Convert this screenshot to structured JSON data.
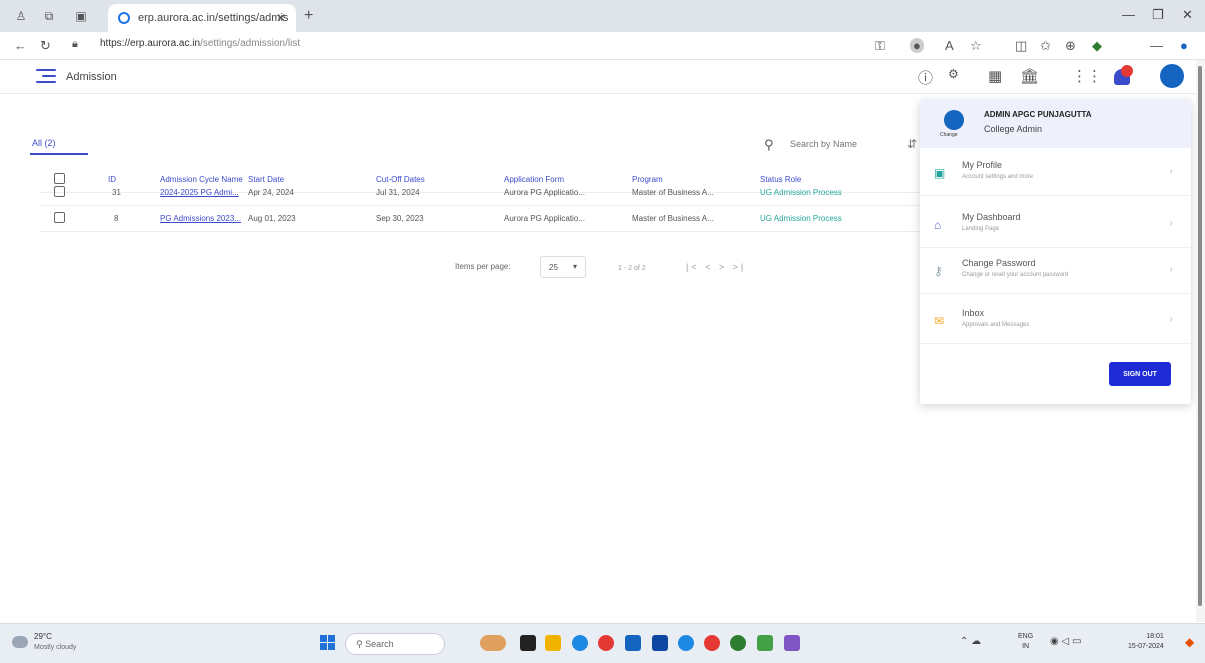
{
  "browser": {
    "tab_title": "erp.aurora.ac.in/settings/admis",
    "url_main": "https://erp.aurora.ac.in",
    "url_rest": "/settings/admission/list"
  },
  "header": {
    "title": "Admission"
  },
  "toolbar": {
    "all_tab": "All (2)",
    "search_placeholder": "Search by Name"
  },
  "table": {
    "columns": [
      "ID",
      "Admission Cycle Name",
      "Start Date",
      "Cut-Off Dates",
      "Application Form",
      "Program",
      "Status Role"
    ],
    "rows": [
      {
        "id": "31",
        "name": "2024-2025 PG Admi...",
        "start": "Apr 24, 2024",
        "cutoff": "Jul 31, 2024",
        "form": "Aurora PG Applicatio...",
        "program": "Master of Business A...",
        "status": "UG Admission Process"
      },
      {
        "id": "8",
        "name": "PG Admissions 2023...",
        "start": "Aug 01, 2023",
        "cutoff": "Sep 30, 2023",
        "form": "Aurora PG Applicatio...",
        "program": "Master of Business A...",
        "status": "UG Admission Process"
      }
    ]
  },
  "pagination": {
    "items_label": "Items per page:",
    "per_page": "25",
    "range": "1 - 2 of 2",
    "buttons": "|< < > >|"
  },
  "profile_menu": {
    "name": "ADMIN APGC PUNJAGUTTA",
    "role": "College Admin",
    "change_label": "Change",
    "items": [
      {
        "title": "My Profile",
        "subtitle": "Account settings and more"
      },
      {
        "title": "My Dashboard",
        "subtitle": "Landing Page"
      },
      {
        "title": "Change Password",
        "subtitle": "Change or reset your account password"
      },
      {
        "title": "Inbox",
        "subtitle": "Approvals and Messages"
      }
    ],
    "signout": "SIGN OUT"
  },
  "taskbar": {
    "temp": "29°C",
    "weather": "Mostly cloudy",
    "search": "Search",
    "lang_1": "ENG",
    "lang_2": "IN",
    "time": "18:01",
    "date": "15-07-2024"
  },
  "colors": {
    "accent": "#3b4cca",
    "signout": "#1e2bd6",
    "status": "#26a69a",
    "bell_dot": "#e53935"
  }
}
